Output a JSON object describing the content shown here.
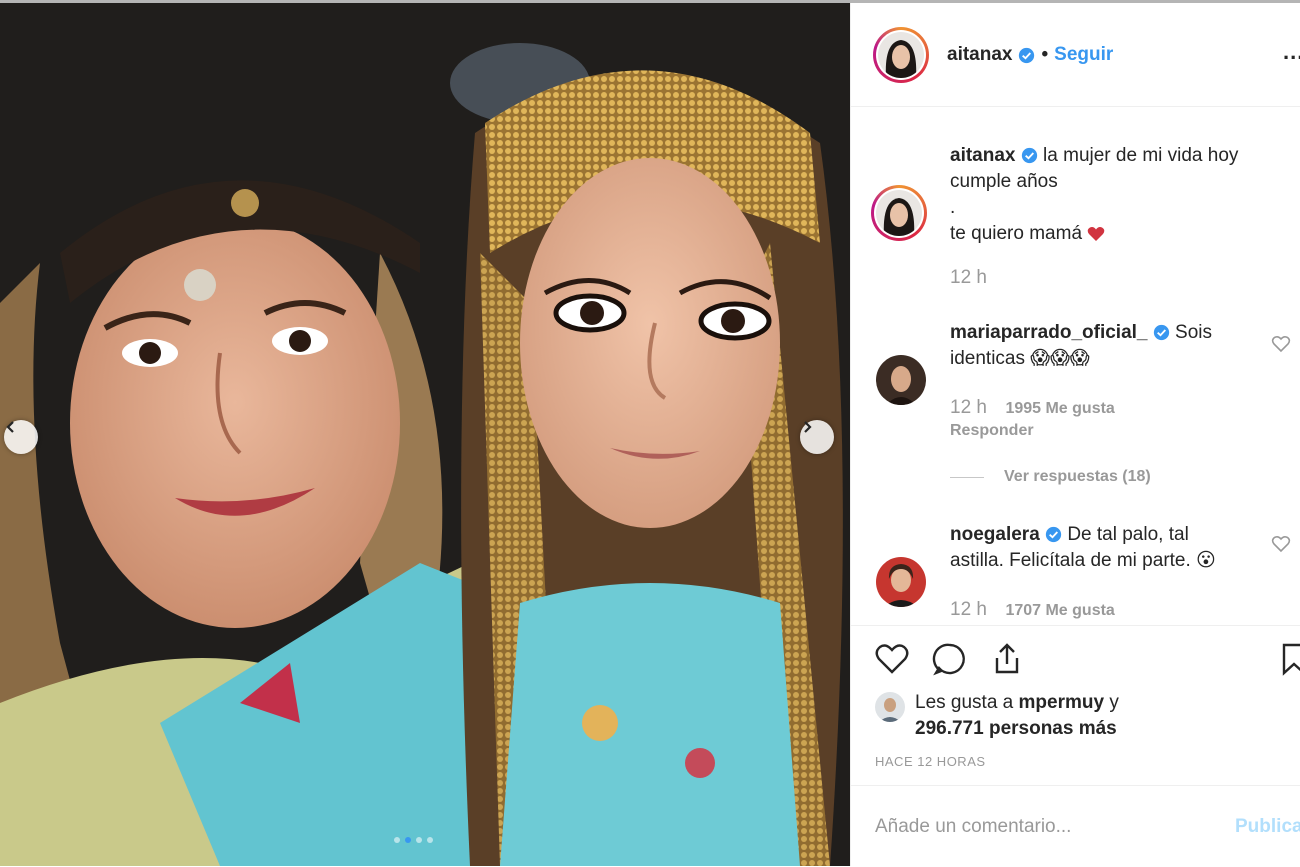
{
  "post": {
    "photo": {
      "description_icon": "photo-mother-daughter",
      "carousel_dots": 4,
      "carousel_active_index": 1
    }
  },
  "header": {
    "username": "aitanax",
    "separator": "•",
    "follow_label": "Seguir",
    "more_label": "..."
  },
  "caption": {
    "username": "aitanax",
    "text_line1": "la mujer de mi vida hoy",
    "text_line2": "cumple años",
    "text_line3": ".",
    "text_line4": "te quiero mamá",
    "time": "12 h"
  },
  "comments": [
    {
      "username": "mariaparrado_oficial_",
      "text_inline": "Sois",
      "text_line2": "identicas 😱😱😱",
      "time": "12 h",
      "likes": "1995 Me gusta",
      "reply": "Responder",
      "view_replies": "Ver respuestas (18)"
    },
    {
      "username": "noegalera",
      "text_inline": "De tal palo, tal",
      "text_line2": "astilla. Felicítala de mi parte. 😮",
      "time": "12 h",
      "likes": "1707 Me gusta"
    }
  ],
  "likes": {
    "prefix": "Les gusta a",
    "user": "mpermuy",
    "connector": "y",
    "count": "296.771 personas más"
  },
  "timestamp": "HACE 12 HORAS",
  "add_comment": {
    "placeholder": "Añade un comentario...",
    "post_label": "Publicar"
  },
  "colors": {
    "accent": "#3897f0",
    "post_disabled": "#b2dffc",
    "text": "#262626",
    "muted": "#999999"
  }
}
